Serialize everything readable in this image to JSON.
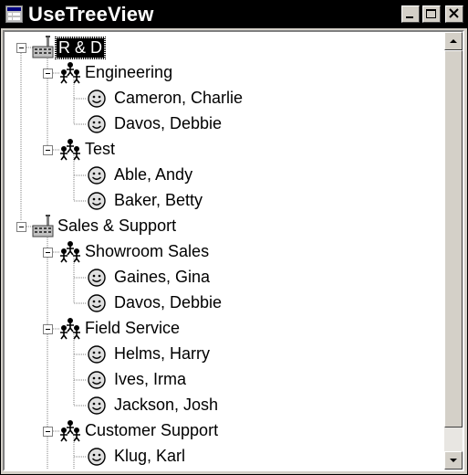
{
  "window": {
    "title": "UseTreeView",
    "app_icon": "treeview-app-icon"
  },
  "title_buttons": {
    "minimize": "minimize-icon",
    "maximize": "maximize-icon",
    "close": "close-icon"
  },
  "tree": {
    "nodes": [
      {
        "label": "R & D",
        "type": "department",
        "depth": 0,
        "expanded": true,
        "selected": true
      },
      {
        "label": "Engineering",
        "type": "group",
        "depth": 1,
        "expanded": true
      },
      {
        "label": "Cameron, Charlie",
        "type": "person",
        "depth": 2
      },
      {
        "label": "Davos, Debbie",
        "type": "person",
        "depth": 2
      },
      {
        "label": "Test",
        "type": "group",
        "depth": 1,
        "expanded": true
      },
      {
        "label": "Able, Andy",
        "type": "person",
        "depth": 2
      },
      {
        "label": "Baker, Betty",
        "type": "person",
        "depth": 2
      },
      {
        "label": "Sales & Support",
        "type": "department",
        "depth": 0,
        "expanded": true
      },
      {
        "label": "Showroom Sales",
        "type": "group",
        "depth": 1,
        "expanded": true
      },
      {
        "label": "Gaines, Gina",
        "type": "person",
        "depth": 2
      },
      {
        "label": "Davos, Debbie",
        "type": "person",
        "depth": 2
      },
      {
        "label": "Field Service",
        "type": "group",
        "depth": 1,
        "expanded": true
      },
      {
        "label": "Helms, Harry",
        "type": "person",
        "depth": 2
      },
      {
        "label": "Ives, Irma",
        "type": "person",
        "depth": 2
      },
      {
        "label": "Jackson, Josh",
        "type": "person",
        "depth": 2
      },
      {
        "label": "Customer Support",
        "type": "group",
        "depth": 1,
        "expanded": true
      },
      {
        "label": "Klug, Karl",
        "type": "person",
        "depth": 2
      }
    ]
  },
  "scrollbar": {
    "up": "scroll-up-arrow-icon",
    "down": "scroll-down-arrow-icon"
  }
}
